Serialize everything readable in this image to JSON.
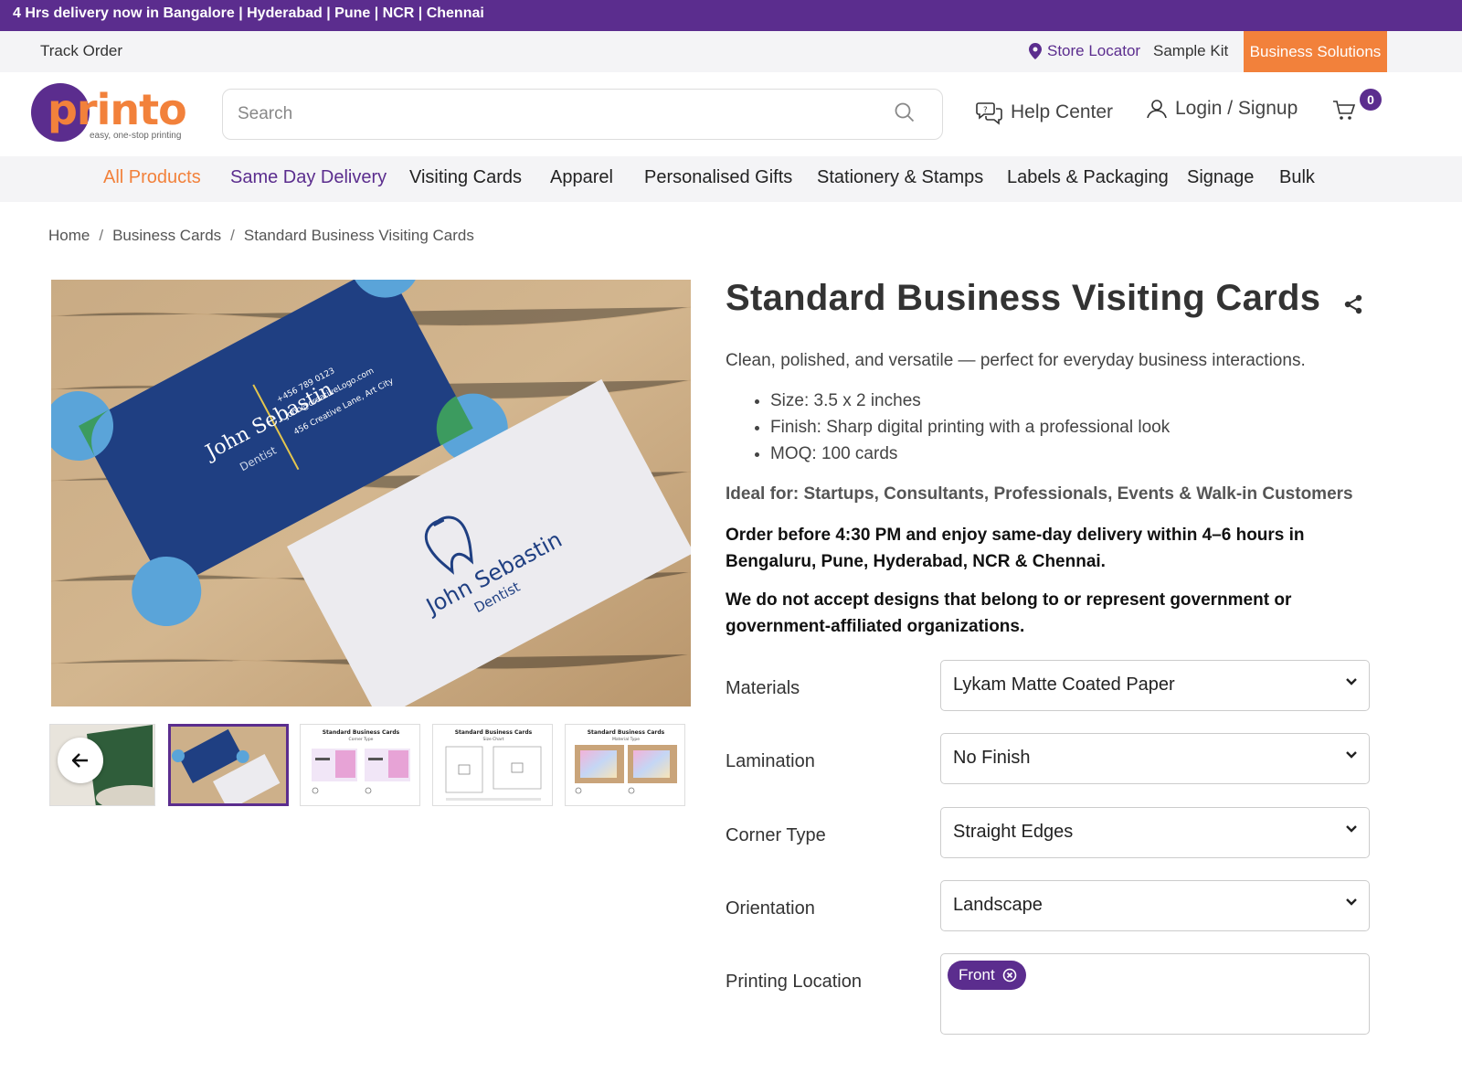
{
  "announcement": "4 Hrs delivery now in Bangalore | Hyderabad | Pune | NCR | Chennai",
  "utility": {
    "track_order": "Track Order",
    "store_locator": "Store Locator",
    "sample_kit": "Sample Kit",
    "business_solutions": "Business Solutions"
  },
  "header": {
    "logo_text": "printo",
    "logo_tagline": "easy, one-stop printing",
    "search_placeholder": "Search",
    "help_center": "Help Center",
    "login": "Login / Signup",
    "cart_count": "0"
  },
  "nav": [
    "All Products",
    "Same Day Delivery",
    "Visiting Cards",
    "Apparel",
    "Personalised Gifts",
    "Stationery & Stamps",
    "Labels & Packaging",
    "Signage",
    "Bulk"
  ],
  "breadcrumb": [
    "Home",
    "Business Cards",
    "Standard Business Visiting Cards"
  ],
  "product": {
    "title": "Standard Business Visiting Cards",
    "description": "Clean, polished, and versatile — perfect for everyday business interactions.",
    "bullets": [
      "Size: 3.5 x 2 inches",
      "Finish: Sharp digital printing with a professional look",
      "MOQ: 100 cards"
    ],
    "ideal_for": "Ideal for: Startups, Consultants, Professionals, Events & Walk-in Customers",
    "order_note": "Order before 4:30 PM and enjoy same-day delivery within 4–6 hours in Bengaluru, Pune, Hyderabad, NCR & Chennai.",
    "design_notice": "We do not accept designs that belong to or represent government or government-affiliated organizations."
  },
  "card_image": {
    "name": "John Sebastin",
    "role": "Dentist",
    "phone": "+456 789 0123",
    "email": "john@creativeLogo.com",
    "address": "456 Creative Lane, Art City"
  },
  "thumbnails": {
    "corner_title": "Standard Business Cards",
    "corner_sub": "Corner Type",
    "size_title": "Standard Business Cards",
    "size_sub": "Size Chart",
    "material_title": "Standard Business Cards",
    "material_sub": "Material Type"
  },
  "options": {
    "materials": {
      "label": "Materials",
      "value": "Lykam Matte Coated Paper"
    },
    "lamination": {
      "label": "Lamination",
      "value": "No Finish"
    },
    "corner_type": {
      "label": "Corner Type",
      "value": "Straight Edges"
    },
    "orientation": {
      "label": "Orientation",
      "value": "Landscape"
    },
    "printing_location": {
      "label": "Printing Location",
      "chips": [
        "Front"
      ]
    }
  },
  "colors": {
    "brand_purple": "#5b2d8e",
    "brand_orange": "#f2813b"
  }
}
